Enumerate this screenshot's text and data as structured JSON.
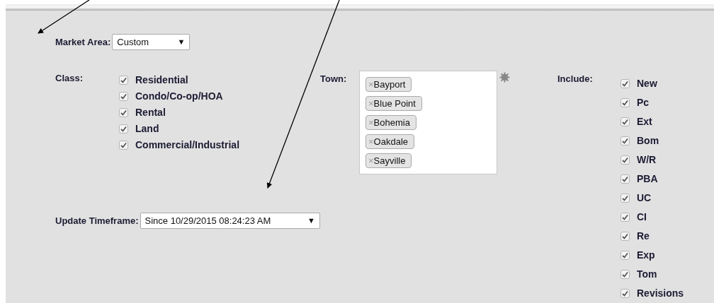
{
  "market_area": {
    "label": "Market Area:",
    "value": "Custom",
    "caret": "▼"
  },
  "class_filter": {
    "label": "Class:",
    "options": [
      {
        "label": "Residential",
        "checked": true
      },
      {
        "label": "Condo/Co-op/HOA",
        "checked": true
      },
      {
        "label": "Rental",
        "checked": true
      },
      {
        "label": "Land",
        "checked": true
      },
      {
        "label": "Commercial/Industrial",
        "checked": true
      }
    ]
  },
  "town": {
    "label": "Town:",
    "tags": [
      {
        "remove": "×",
        "label": "Bayport"
      },
      {
        "remove": "×",
        "label": "Blue Point"
      },
      {
        "remove": "×",
        "label": "Bohemia"
      },
      {
        "remove": "×",
        "label": "Oakdale"
      },
      {
        "remove": "×",
        "label": "Sayville"
      }
    ]
  },
  "include": {
    "label": "Include:",
    "options": [
      {
        "label": "New",
        "checked": true
      },
      {
        "label": "Pc",
        "checked": true
      },
      {
        "label": "Ext",
        "checked": true
      },
      {
        "label": "Bom",
        "checked": true
      },
      {
        "label": "W/R",
        "checked": true
      },
      {
        "label": "PBA",
        "checked": true
      },
      {
        "label": "UC",
        "checked": true
      },
      {
        "label": "CI",
        "checked": true
      },
      {
        "label": "Re",
        "checked": true
      },
      {
        "label": "Exp",
        "checked": true
      },
      {
        "label": "Tom",
        "checked": true
      },
      {
        "label": "Revisions",
        "checked": true
      }
    ]
  },
  "update_timeframe": {
    "label": "Update Timeframe:",
    "value": "Since 10/29/2015 08:24:23 AM",
    "caret": "▼"
  }
}
